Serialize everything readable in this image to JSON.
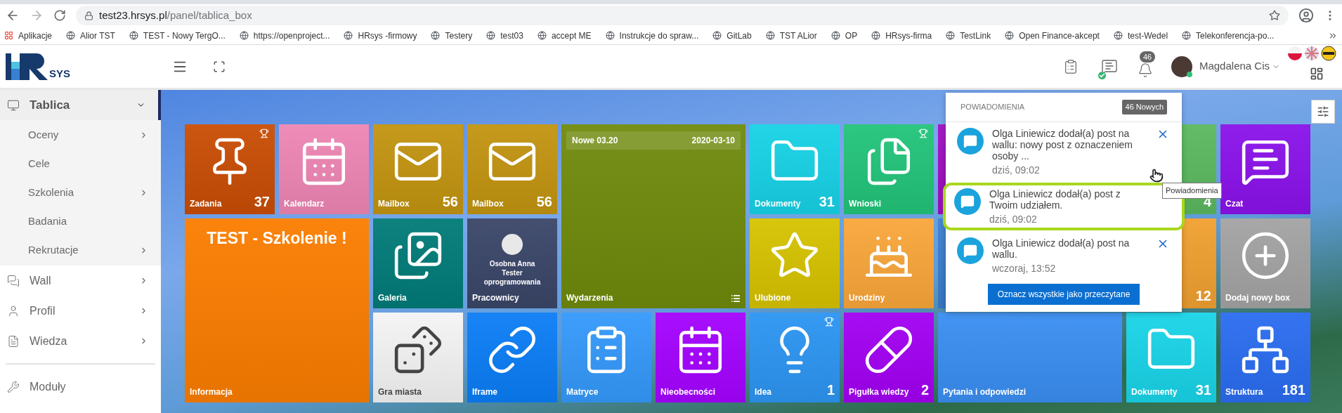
{
  "browser": {
    "url_host": "test23.hrsys.pl",
    "url_path": "/panel/tablica_box",
    "bookmarks": [
      {
        "label": "Aplikacje",
        "kind": "apps"
      },
      {
        "label": "Alior TST",
        "kind": "site"
      },
      {
        "label": "TEST - Nowy TergO...",
        "kind": "site"
      },
      {
        "label": "https://openproject...",
        "kind": "site"
      },
      {
        "label": "HRsys -firmowy",
        "kind": "site"
      },
      {
        "label": "Testery",
        "kind": "site"
      },
      {
        "label": "test03",
        "kind": "site"
      },
      {
        "label": "accept ME",
        "kind": "site"
      },
      {
        "label": "Instrukcje do spraw...",
        "kind": "site"
      },
      {
        "label": "GitLab",
        "kind": "site"
      },
      {
        "label": "TST ALior",
        "kind": "site"
      },
      {
        "label": "OP",
        "kind": "site"
      },
      {
        "label": "HRsys-firma",
        "kind": "site"
      },
      {
        "label": "TestLink",
        "kind": "site"
      },
      {
        "label": "Open Finance-akcept",
        "kind": "site"
      },
      {
        "label": "test-Wedel",
        "kind": "site"
      },
      {
        "label": "Telekonferencja-po...",
        "kind": "site"
      }
    ]
  },
  "header": {
    "logo": "SYS",
    "bell_count": "46",
    "user_name": "Magdalena Cis"
  },
  "sidebar": {
    "items": [
      {
        "label": "Tablica",
        "selected": true,
        "expanded": true,
        "children": [
          {
            "label": "Oceny",
            "submenu": true
          },
          {
            "label": "Cele",
            "submenu": false
          },
          {
            "label": "Szkolenia",
            "submenu": true
          },
          {
            "label": "Badania",
            "submenu": false
          },
          {
            "label": "Rekrutacje",
            "submenu": true
          }
        ]
      },
      {
        "label": "Wall",
        "selected": false,
        "expanded": false
      },
      {
        "label": "Profil",
        "selected": false,
        "expanded": false
      },
      {
        "label": "Wiedza",
        "selected": false,
        "expanded": false
      },
      {
        "label": "Moduły",
        "selected": false,
        "expanded": false
      }
    ]
  },
  "tiles": [
    {
      "kind": "icon",
      "label": "Zadania",
      "count": "37",
      "trophy": true,
      "color": "#c94d05"
    },
    {
      "kind": "icon",
      "label": "Kalendarz",
      "trophy": false,
      "color": "#ee86b4"
    },
    {
      "kind": "icon",
      "label": "Mailbox",
      "count": "56",
      "trophy": false,
      "color": "#c29410"
    },
    {
      "kind": "icon",
      "label": "Mailbox",
      "count": "56",
      "trophy": false,
      "color": "#c29410"
    },
    {
      "kind": "events",
      "label": "Wydarzenia",
      "event_title": "Nowe 03.20",
      "event_date": "2020-03-10",
      "trophy": false,
      "color": "#6f8a0c"
    },
    {
      "kind": "icon",
      "label": "Dokumenty",
      "count": "31",
      "trophy": false,
      "color": "#17d2e6"
    },
    {
      "kind": "icon",
      "label": "Wnioski",
      "trophy": true,
      "color": "#22c47a"
    },
    {
      "kind": "icon",
      "trophy": false,
      "color": "#a00fc2"
    },
    {
      "kind": "icon",
      "count": "4",
      "trophy": false,
      "color": "#5bb85f"
    },
    {
      "kind": "icon",
      "label": "Czat",
      "trophy": false,
      "color": "#8a12ea"
    },
    {
      "kind": "text",
      "label": "Informacja",
      "headline": "TEST - Szkolenie !",
      "trophy": false,
      "color": "#fb7d00"
    },
    {
      "kind": "icon",
      "label": "Galeria",
      "trophy": false,
      "color": "#017b78"
    },
    {
      "kind": "person",
      "label": "Pracownicy",
      "person_name": "Osobna Anna",
      "person_role": "Tester oprogramowania",
      "trophy": false,
      "color": "#3a4668"
    },
    {
      "kind": "icon",
      "label": "Ulubione",
      "trophy": false,
      "color": "#d6c200"
    },
    {
      "kind": "icon",
      "label": "Urodziny",
      "trophy": false,
      "color": "#f9a63a"
    },
    {
      "kind": "icon",
      "trophy": false,
      "color": "#3b7fd0"
    },
    {
      "kind": "icon",
      "count": "12",
      "trophy": false,
      "color": "#f0a030"
    },
    {
      "kind": "icon",
      "label": "Dodaj nowy box",
      "trophy": false,
      "color": "#a3a3a3"
    },
    {
      "kind": "icon",
      "label": "Gra miasta",
      "trophy": false,
      "color": "#f4f4f4"
    },
    {
      "kind": "icon",
      "label": "Iframe",
      "trophy": false,
      "color": "#0b7df6"
    },
    {
      "kind": "icon",
      "label": "Matryce",
      "trophy": false,
      "color": "#3499fb"
    },
    {
      "kind": "icon",
      "label": "Nieobecności",
      "trophy": false,
      "color": "#a402ff"
    },
    {
      "kind": "icon",
      "label": "Idea",
      "count": "1",
      "trophy": true,
      "color": "#2c95f2"
    },
    {
      "kind": "icon",
      "label": "Pigułka wiedzy",
      "count": "2",
      "trophy": false,
      "color": "#a200f2"
    },
    {
      "kind": "icon",
      "label": "Pytania i odpowiedzi",
      "trophy": false,
      "color": "#3a8ef2"
    },
    {
      "kind": "icon",
      "label": "Dokumenty",
      "count": "31",
      "trophy": false,
      "color": "#19d4e8"
    },
    {
      "kind": "icon",
      "label": "Struktura",
      "count": "181",
      "trophy": false,
      "color": "#2a6cf0"
    }
  ],
  "notifications": {
    "title": "POWIADOMIENIA",
    "badge": "46 Nowych",
    "items": [
      {
        "text": "Olga Liniewicz dodał(a) post na wallu: nowy post z oznaczeniem osoby ...",
        "time": "dziś, 09:02",
        "highlighted": false
      },
      {
        "text": "Olga Liniewicz dodał(a) post z Twoim udziałem.",
        "time": "dziś, 09:02",
        "highlighted": true
      },
      {
        "text": "Olga Liniewicz dodał(a) post na wallu.",
        "time": "wczoraj, 13:52",
        "highlighted": false
      }
    ],
    "button": "Oznacz wszystkie jako przeczytane"
  },
  "tooltip": "Powiadomienia"
}
